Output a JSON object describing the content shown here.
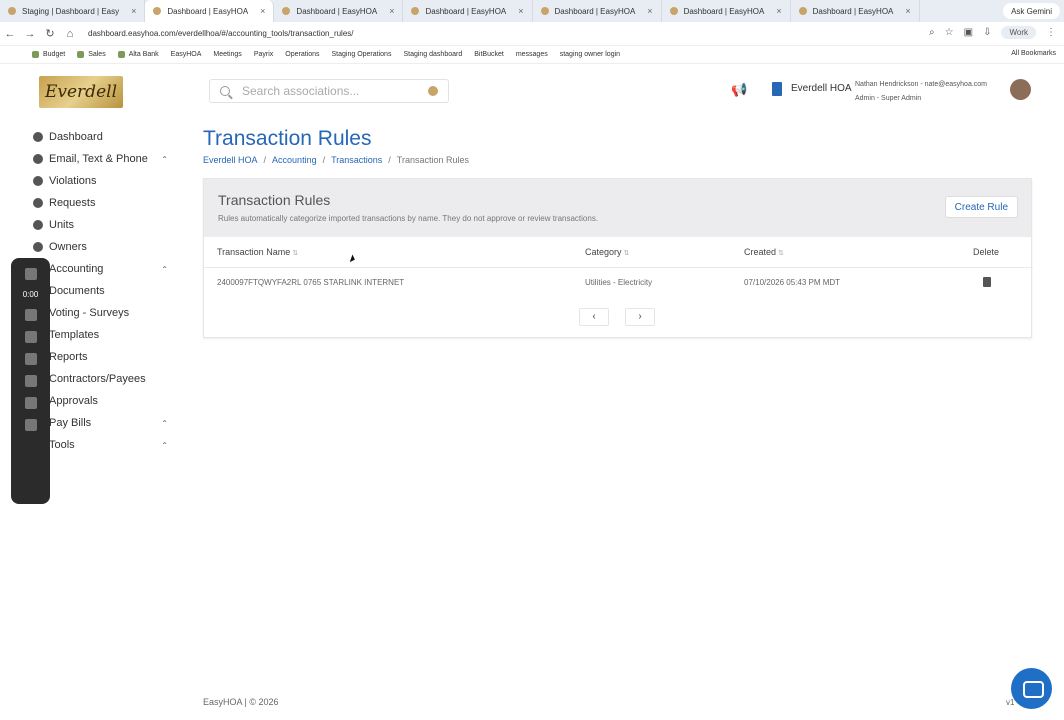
{
  "browser": {
    "tabs": [
      {
        "label": "Staging | Dashboard | Easy"
      },
      {
        "label": "Dashboard | EasyHOA"
      },
      {
        "label": "Dashboard | EasyHOA"
      },
      {
        "label": "Dashboard | EasyHOA"
      },
      {
        "label": "Dashboard | EasyHOA"
      },
      {
        "label": "Dashboard | EasyHOA"
      },
      {
        "label": "Dashboard | EasyHOA"
      }
    ],
    "ask_label": "Ask Gemini",
    "url": "dashboard.easyhoa.com/everdellhoa/#/accounting_tools/transaction_rules/",
    "profile": "Work",
    "bookmarks": [
      "Budget",
      "Sales",
      "Alta Bank",
      "EasyHOA",
      "Meetings",
      "Payrix",
      "Operations",
      "Staging Operations",
      "Staging dashboard",
      "BitBucket",
      "messages",
      "staging owner login"
    ],
    "all_bookmarks": "All Bookmarks"
  },
  "header": {
    "logo_text": "Everdell",
    "search_placeholder": "Search associations...",
    "hoa_name": "Everdell HOA",
    "user": "Nathan Hendrickson - nate@easyhoa.com",
    "role": "Admin - Super Admin"
  },
  "sidebar": {
    "items": [
      {
        "label": "Dashboard"
      },
      {
        "label": "Email, Text & Phone"
      },
      {
        "label": "Violations"
      },
      {
        "label": "Requests"
      },
      {
        "label": "Units"
      },
      {
        "label": "Owners"
      },
      {
        "label": "Accounting"
      },
      {
        "label": "Documents"
      },
      {
        "label": "Voting - Surveys"
      },
      {
        "label": "Templates"
      },
      {
        "label": "Reports"
      },
      {
        "label": "Contractors/Payees"
      },
      {
        "label": "Approvals"
      },
      {
        "label": "Pay Bills"
      },
      {
        "label": "Tools"
      }
    ]
  },
  "recorder": {
    "time": "0:00"
  },
  "page": {
    "title": "Transaction Rules",
    "breadcrumb": [
      "Everdell HOA",
      "Accounting",
      "Transactions",
      "Transaction Rules"
    ],
    "panel_title": "Transaction Rules",
    "panel_desc": "Rules automatically categorize imported transactions by name. They do not approve or review transactions.",
    "create_label": "Create Rule",
    "columns": [
      "Transaction Name",
      "Category",
      "Created",
      "Delete"
    ],
    "rows": [
      {
        "name": "2400097FTQWYFA2RL 0765 STARLINK INTERNET",
        "category": "Utilities - Electricity",
        "created": "07/10/2026 05:43 PM MDT"
      }
    ]
  },
  "footer": {
    "text": "EasyHOA | © 2026",
    "version": "v1"
  }
}
